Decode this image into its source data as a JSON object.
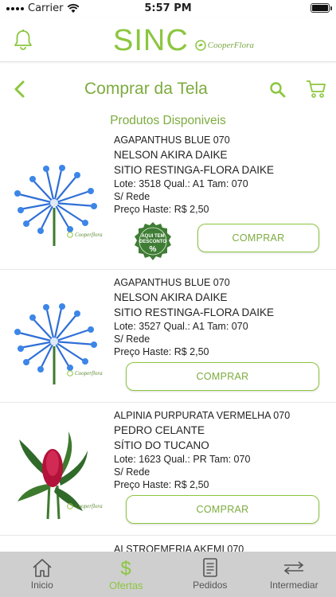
{
  "status_bar": {
    "carrier": "Carrier",
    "time": "5:57 PM"
  },
  "header": {
    "brand": "SINC",
    "partner_logo": "CooperFlora"
  },
  "titlebar": {
    "title": "Comprar da Tela"
  },
  "section": {
    "title": "Produtos Disponiveis"
  },
  "products": [
    {
      "name": "AGAPANTHUS BLUE 070",
      "producer": "NELSON AKIRA DAIKE",
      "farm": "SITIO RESTINGA-FLORA DAIKE",
      "lot_line": "Lote: 3518  Qual.: A1 Tam: 070",
      "network": "S/ Rede",
      "price_line": "Preço Haste:  R$ 2,50",
      "button": "COMPRAR",
      "badge": {
        "line1": "AQUI TEM",
        "line2": "DESCONTO",
        "symbol": "%"
      },
      "image_logo": "Cooperflora"
    },
    {
      "name": "AGAPANTHUS BLUE 070",
      "producer": "NELSON AKIRA DAIKE",
      "farm": "SITIO RESTINGA-FLORA DAIKE",
      "lot_line": "Lote: 3527  Qual.: A1 Tam: 070",
      "network": "S/ Rede",
      "price_line": "Preço Haste:  R$ 2,50",
      "button": "COMPRAR",
      "image_logo": "Cooperflora"
    },
    {
      "name": "ALPINIA PURPURATA VERMELHA 070",
      "producer": "PEDRO CELANTE",
      "farm": "SÍTIO DO TUCANO",
      "lot_line": "Lote: 1623  Qual.: PR Tam: 070",
      "network": "S/ Rede",
      "price_line": "Preço Haste:  R$ 2,50",
      "button": "COMPRAR",
      "image_logo": "Cooperflora"
    },
    {
      "name": "ALSTROEMERIA AKEMI 070"
    }
  ],
  "tabs": [
    {
      "label": "Inicio",
      "icon": "home-icon"
    },
    {
      "label": "Ofertas",
      "icon": "dollar-icon",
      "active": true
    },
    {
      "label": "Pedidos",
      "icon": "document-icon"
    },
    {
      "label": "Intermediar",
      "icon": "transfer-icon"
    }
  ],
  "colors": {
    "accent": "#8cc63f",
    "accent_dark": "#7dab3f",
    "tabbar_bg": "#cfcfcf",
    "agapanthus": "#2f6fd6",
    "alpinia": "#b3123a"
  }
}
